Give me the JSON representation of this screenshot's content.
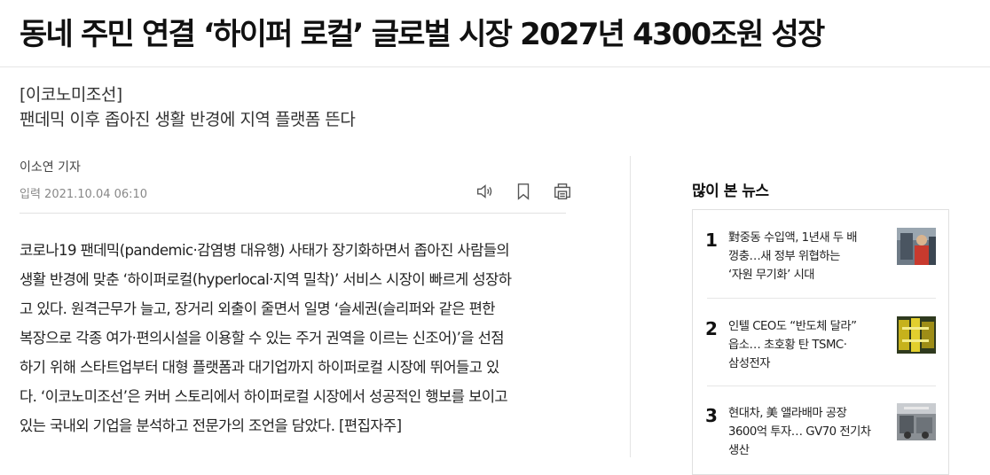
{
  "article": {
    "headline": "동네 주민 연결 ‘하이퍼 로컬’ 글로벌 시장 2027년 4300조원 성장",
    "section": "[이코노미조선]",
    "subhead": "팬데믹 이후 좁아진 생활 반경에 지역 플랫폼 뜬다",
    "byline": "이소연 기자",
    "date": "입력 2021.10.04 06:10",
    "body_lines": [
      "코로나19 팬데믹(pandemic·감염병 대유행) 사태가 장기화하면서 좁아진 사람들의",
      "생활 반경에 맞춘 ‘하이퍼로컬(hyperlocal·지역 밀착)’ 서비스 시장이 빠르게 성장하",
      "고 있다. 원격근무가 늘고, 장거리 외출이 줄면서 일명 ‘슬세권(슬리퍼와 같은 편한",
      "복장으로 각종 여가·편의시설을 이용할 수 있는 주거 권역을 이르는 신조어)’을 선점",
      "하기 위해 스타트업부터 대형 플랫폼과 대기업까지 하이퍼로컬 시장에 뛰어들고 있",
      "다. ‘이코노미조선’은 커버 스토리에서 하이퍼로컬 시장에서 성공적인 행보를 보이고",
      "있는 국내외 기업을 분석하고 전문가의 조언을 담았다. [편집자주]"
    ]
  },
  "toolbar": {
    "icons": [
      "speaker-icon",
      "bookmark-icon",
      "print-icon"
    ]
  },
  "sidebar": {
    "title": "많이 본 뉴스",
    "items": [
      {
        "rank": "1",
        "lines": [
          "對중동 수입액, 1년새 두 배",
          "껑충…새 정부 위협하는",
          "‘자원 무기화’ 시대"
        ],
        "thumb": "worker-photo"
      },
      {
        "rank": "2",
        "lines": [
          "인텔 CEO도 “반도체 달라”",
          "읍소… 초호황 탄 TSMC·",
          "삼성전자"
        ],
        "thumb": "semiconductor-photo"
      },
      {
        "rank": "3",
        "lines": [
          "현대차, 美 앨라배마 공장",
          "3600억 투자… GV70 전기차",
          "생산"
        ],
        "thumb": "factory-photo"
      }
    ]
  },
  "colors": {
    "text": "#111111",
    "muted": "#888888",
    "border": "#e0e0e0"
  }
}
